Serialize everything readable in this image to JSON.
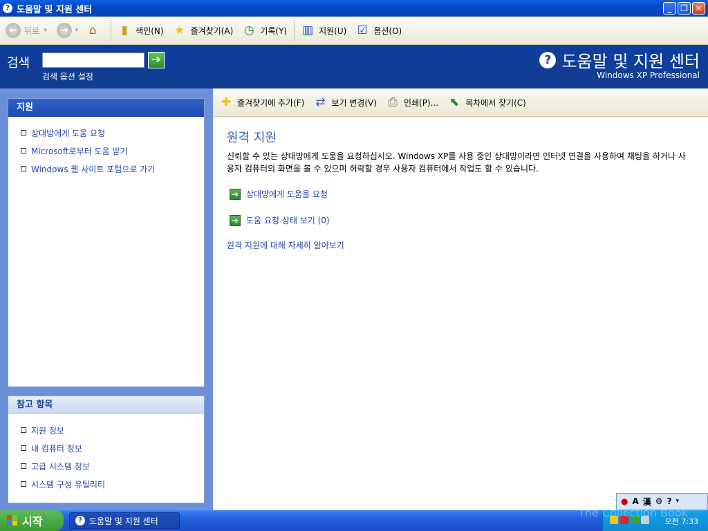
{
  "window": {
    "title": "도움말 및 지원 센터"
  },
  "toolbar": {
    "back": "뒤로",
    "index": "색인(N)",
    "favorites": "즐겨찾기(A)",
    "history": "기록(Y)",
    "support": "지원(U)",
    "options": "옵션(O)"
  },
  "search": {
    "label": "검색",
    "value": "",
    "options_link": "검색 옵션 설정"
  },
  "header": {
    "title": "도움말 및 지원 센터",
    "subtitle": "Windows XP Professional"
  },
  "sidebar": {
    "support_title": "지원",
    "support_items": [
      {
        "label": "상대방에게 도움 요청"
      },
      {
        "label": "Microsoft로부터 도움 받기"
      },
      {
        "label": "Windows 웹 사이트 포럼으로 가기"
      }
    ],
    "related_title": "참고 항목",
    "related_items": [
      {
        "label": "지원 정보"
      },
      {
        "label": "내 컴퓨터 정보"
      },
      {
        "label": "고급 시스템 정보"
      },
      {
        "label": "시스템 구성 유틸리티"
      }
    ]
  },
  "commands": {
    "add_fav": "즐겨찾기에 추가(F)",
    "change_view": "보기 변경(V)",
    "print": "인쇄(P)...",
    "locate": "목차에서 찾기(C)"
  },
  "content": {
    "heading": "원격 지원",
    "description": "신뢰할 수 있는 상대방에게 도움을 요청하십시오. Windows XP를 사용 중인 상대방이라면 인터넷 연결을 사용하여 채팅을 하거나 사용자 컴퓨터의 화면을 볼 수 있으며 허락할 경우 사용자 컴퓨터에서 작업도 할 수 있습니다.",
    "invite_link": "상대방에게 도움을 요청",
    "status_link": "도움 요청 상태 보기 (0)",
    "learn_link": "원격 지원에 대해 자세히 알아보기"
  },
  "taskbar": {
    "start": "시작",
    "task_item": "도움말 및 지원 센터",
    "clock": "오전 7:33"
  },
  "watermark": "The Collection Book",
  "colors": {
    "titlebar": "#0548c8",
    "header": "#123d8f",
    "link": "#2449b0",
    "sidebar_bg": "#6b8fd9"
  }
}
